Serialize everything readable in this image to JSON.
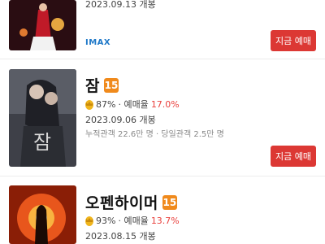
{
  "movies": [
    {
      "open_date": "2023.09.13 개봉",
      "tag": "IMAX",
      "book_label": "지금 예매"
    },
    {
      "title": "잠",
      "age": "15",
      "egg": "87%",
      "rate_label": "· 예매율",
      "rate_value": "17.0%",
      "open_date": "2023.09.06 개봉",
      "audience": "누적관객 22.6만 명 · 당일관객 2.5만 명",
      "book_label": "지금 예매",
      "poster_text": "잠"
    },
    {
      "title": "오펜하이머",
      "age": "15",
      "egg": "93%",
      "rate_label": "· 예매율",
      "rate_value": "13.7%",
      "open_date": "2023.08.15 개봉"
    }
  ]
}
